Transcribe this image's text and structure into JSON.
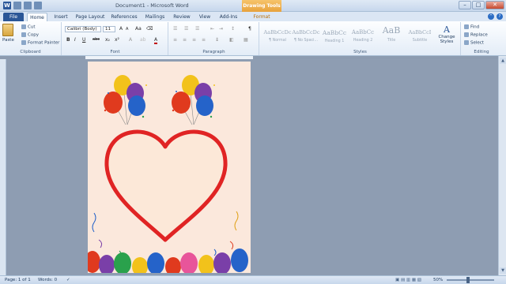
{
  "titlebar": {
    "title": "Document1 - Microsoft Word",
    "context_tab": "Drawing Tools",
    "word_icon": "W"
  },
  "tabs": [
    "File",
    "Home",
    "Insert",
    "Page Layout",
    "References",
    "Mailings",
    "Review",
    "View",
    "Add-Ins",
    "Format"
  ],
  "ribbon": {
    "clipboard": {
      "paste": "Paste",
      "cut": "Cut",
      "copy": "Copy",
      "format_painter": "Format Painter",
      "label": "Clipboard"
    },
    "font": {
      "family": "Calibri (Body)",
      "size": "11",
      "label": "Font",
      "bold": "B",
      "italic": "I",
      "underline": "U",
      "strike": "abc",
      "sub": "x₂",
      "sup": "x²",
      "grow": "A",
      "shrink": "A",
      "case": "Aa",
      "color": "A"
    },
    "paragraph": {
      "label": "Paragraph",
      "pilcrow": "¶"
    },
    "styles": {
      "label": "Styles",
      "items": [
        {
          "sample": "AaBbCcDc",
          "name": "¶ Normal"
        },
        {
          "sample": "AaBbCcDc",
          "name": "¶ No Spaci..."
        },
        {
          "sample": "AaBbCc",
          "name": "Heading 1"
        },
        {
          "sample": "AaBbCc",
          "name": "Heading 2"
        },
        {
          "sample": "AaB",
          "name": "Title"
        },
        {
          "sample": "AaBbCcI",
          "name": "Subtitle"
        }
      ],
      "change_styles": "Change Styles"
    },
    "editing": {
      "label": "Editing",
      "find": "Find",
      "replace": "Replace",
      "select": "Select"
    }
  },
  "statusbar": {
    "page": "Page: 1 of 1",
    "words": "Words: 0",
    "zoom": "50%"
  },
  "colors": {
    "ribbon_blue": "#2b5797",
    "heart_red": "#e02424",
    "heart_fill": "#fce8d8",
    "page_bg": "#fbe8dc",
    "context_orange": "#e8a23c"
  }
}
